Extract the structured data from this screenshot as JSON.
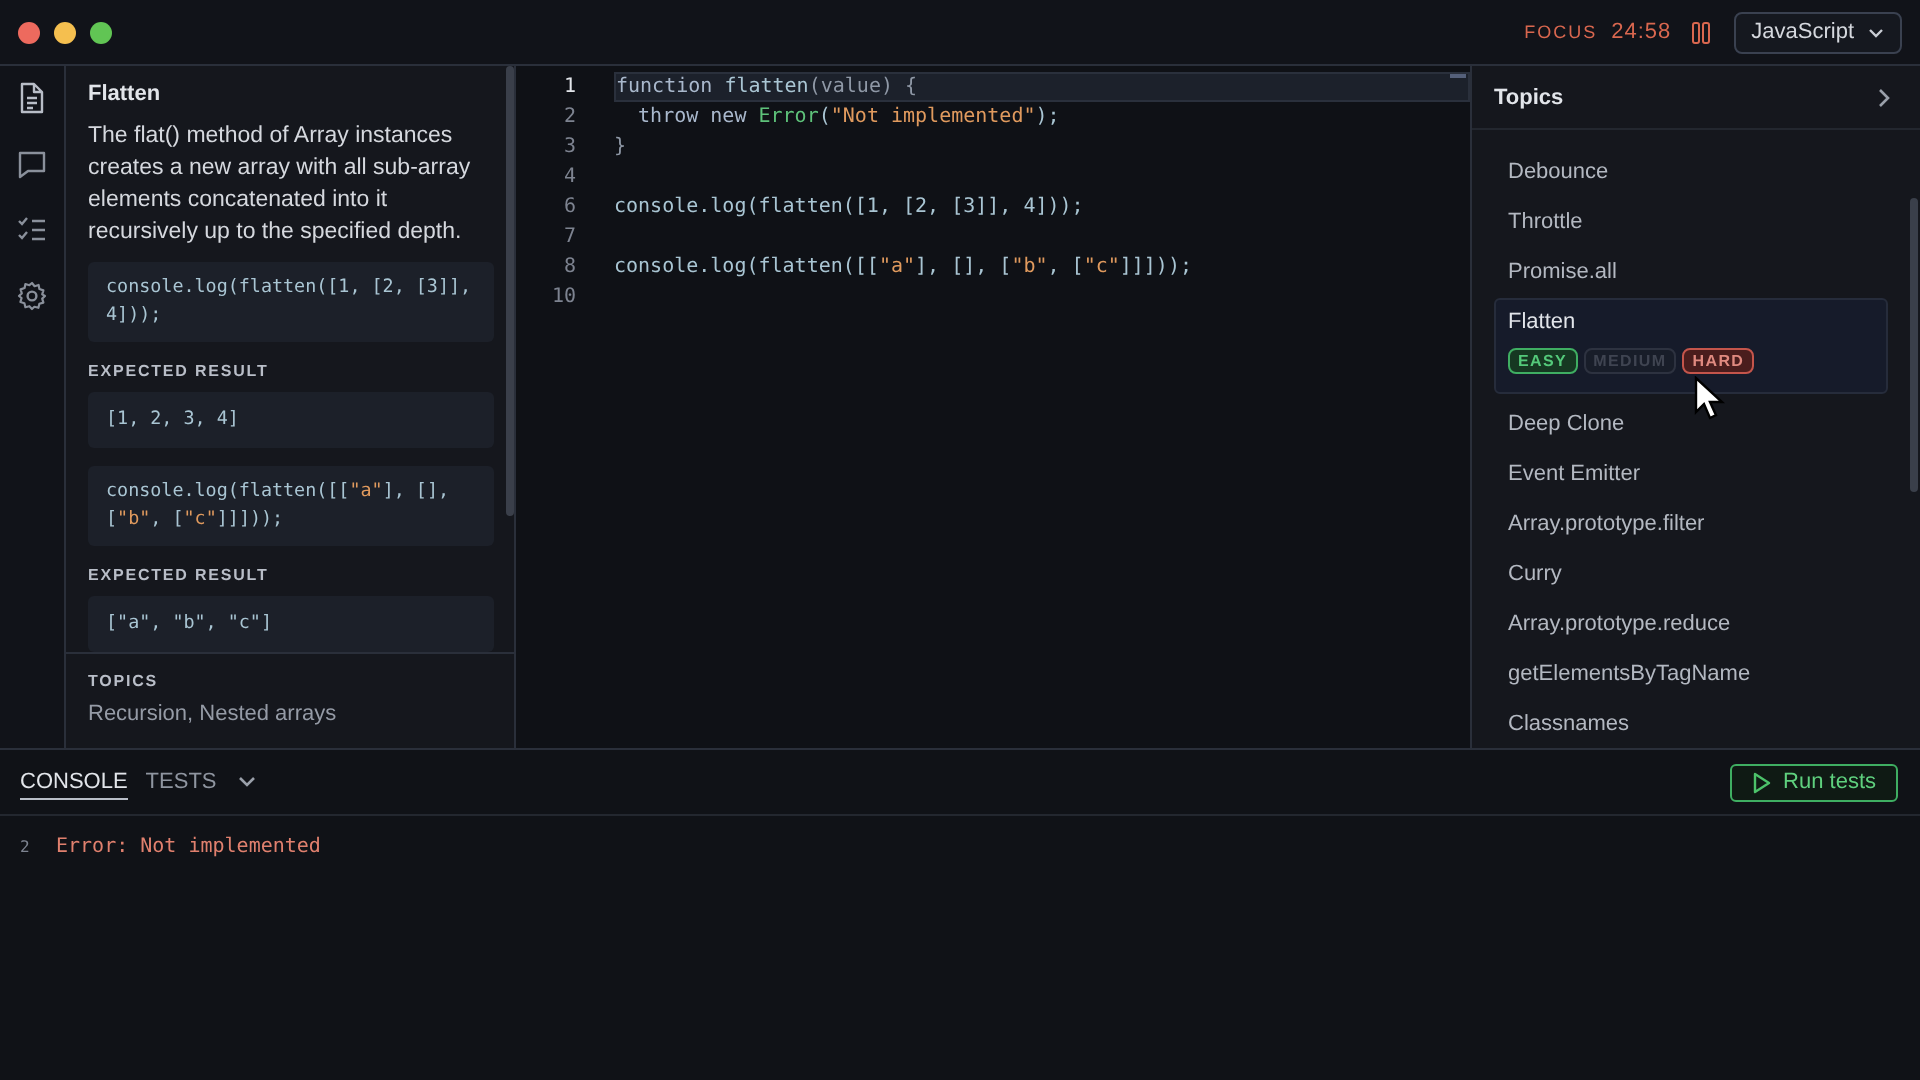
{
  "window": {
    "controls": [
      {
        "kind": "close"
      },
      {
        "kind": "minimize"
      },
      {
        "kind": "zoom"
      }
    ]
  },
  "focus": {
    "label": "FOCUS",
    "time": "24:58"
  },
  "language": {
    "value": "JavaScript"
  },
  "rail": [
    {
      "kind": "document",
      "selected": true
    },
    {
      "kind": "chat",
      "selected": false
    },
    {
      "kind": "checklist",
      "selected": false
    },
    {
      "kind": "settings",
      "selected": false
    }
  ],
  "problem": {
    "title": "Flatten",
    "description": "The flat() method of Array instances creates a new array with all sub-array elements concatenated into it recursively up to the specified depth.",
    "examples": [
      {
        "code": [
          {
            "text": "console.log(flatten([1, [2, [3]], 4]));",
            "kind": "plain"
          }
        ],
        "result_label": "EXPECTED RESULT",
        "result": [
          {
            "text": "[1, 2, 3, 4]",
            "kind": "plain"
          }
        ]
      },
      {
        "code": [
          {
            "text": "console.log(flatten([[",
            "kind": "plain"
          },
          {
            "text": "\"a\"",
            "kind": "string"
          },
          {
            "text": "], [], [",
            "kind": "plain"
          },
          {
            "text": "\"b\"",
            "kind": "string"
          },
          {
            "text": ", [",
            "kind": "plain"
          },
          {
            "text": "\"c\"",
            "kind": "string"
          },
          {
            "text": "]]]));",
            "kind": "plain"
          }
        ],
        "result_label": "EXPECTED RESULT",
        "result": [
          {
            "text": "[\"a\", \"b\", \"c\"]",
            "kind": "plain"
          }
        ]
      }
    ],
    "topics_label": "TOPICS",
    "topics": "Recursion, Nested arrays"
  },
  "editor": {
    "lines": [
      {
        "number": "1",
        "current": true,
        "tokens": [
          {
            "text": "function ",
            "kind": "keyword"
          },
          {
            "text": "flatten",
            "kind": "plain"
          },
          {
            "text": "(value) {",
            "kind": "muted"
          }
        ]
      },
      {
        "number": "2",
        "current": false,
        "tokens": [
          {
            "text": "  throw new ",
            "kind": "keyword"
          },
          {
            "text": "Error",
            "kind": "type"
          },
          {
            "text": "(",
            "kind": "plain"
          },
          {
            "text": "\"Not implemented\"",
            "kind": "string"
          },
          {
            "text": ");",
            "kind": "plain"
          }
        ]
      },
      {
        "number": "3",
        "current": false,
        "tokens": [
          {
            "text": "}",
            "kind": "muted"
          }
        ]
      },
      {
        "number": "4",
        "current": false
      },
      {
        "number": "6",
        "current": false,
        "tokens": [
          {
            "text": "console.log(flatten([1, [2, [3]], 4]));",
            "kind": "plain"
          }
        ]
      },
      {
        "number": "7",
        "current": false
      },
      {
        "number": "8",
        "current": false,
        "tokens": [
          {
            "text": "console.log(flatten([[",
            "kind": "plain"
          },
          {
            "text": "\"a\"",
            "kind": "string"
          },
          {
            "text": "], [], [",
            "kind": "plain"
          },
          {
            "text": "\"b\"",
            "kind": "string"
          },
          {
            "text": ", [",
            "kind": "plain"
          },
          {
            "text": "\"c\"",
            "kind": "string"
          },
          {
            "text": "]]]));",
            "kind": "plain"
          }
        ]
      },
      {
        "number": "10",
        "current": false
      }
    ]
  },
  "topics_panel": {
    "title": "Topics",
    "items": [
      {
        "label": "Debounce",
        "selected": false
      },
      {
        "label": "Throttle",
        "selected": false
      },
      {
        "label": "Promise.all",
        "selected": false
      },
      {
        "label": "Flatten",
        "selected": true,
        "badges": [
          {
            "label": "EASY",
            "kind": "easy",
            "selected": true
          },
          {
            "label": "MEDIUM",
            "kind": "medium",
            "selected": false
          },
          {
            "label": "HARD",
            "kind": "hard",
            "selected": true
          }
        ]
      },
      {
        "label": "Deep Clone",
        "selected": false
      },
      {
        "label": "Event Emitter",
        "selected": false
      },
      {
        "label": "Array.prototype.filter",
        "selected": false
      },
      {
        "label": "Curry",
        "selected": false
      },
      {
        "label": "Array.prototype.reduce",
        "selected": false
      },
      {
        "label": "getElementsByTagName",
        "selected": false
      },
      {
        "label": "Classnames",
        "selected": false
      }
    ]
  },
  "console": {
    "tabs": [
      {
        "label": "CONSOLE",
        "selected": true
      },
      {
        "label": "TESTS",
        "selected": false
      }
    ],
    "run_button": "Run tests",
    "lines": [
      {
        "number": "2",
        "text": "Error: Not implemented",
        "kind": "error"
      }
    ]
  }
}
